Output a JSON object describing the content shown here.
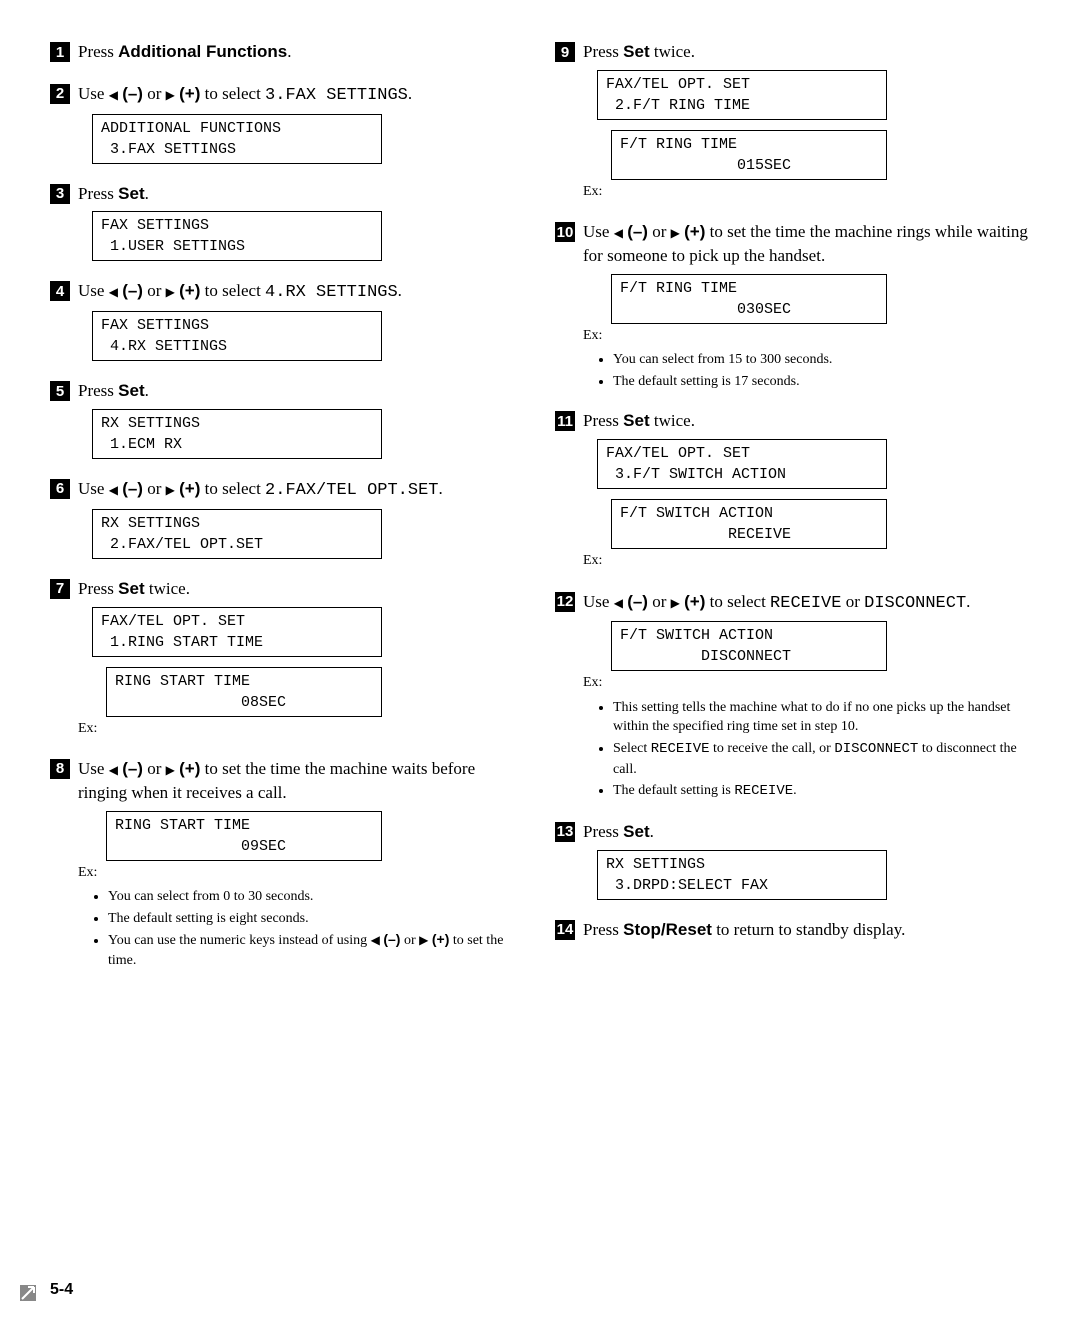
{
  "left": {
    "s1": {
      "text_a": "Press ",
      "bold": "Additional Functions",
      "text_b": "."
    },
    "s2": {
      "text_a": "Use ",
      "minus": "(–)",
      "or": " or ",
      "plus": "(+)",
      "text_b": " to select ",
      "mono": "3.FAX SETTINGS",
      "text_c": ".",
      "disp": "ADDITIONAL FUNCTIONS\n 3.FAX SETTINGS"
    },
    "s3": {
      "text_a": "Press ",
      "bold": "Set",
      "text_b": ".",
      "disp": "FAX SETTINGS\n 1.USER SETTINGS"
    },
    "s4": {
      "text_a": "Use ",
      "minus": "(–)",
      "or": " or ",
      "plus": "(+)",
      "text_b": " to select ",
      "mono": "4.RX SETTINGS",
      "text_c": ".",
      "disp": "FAX SETTINGS\n 4.RX SETTINGS"
    },
    "s5": {
      "text_a": "Press ",
      "bold": "Set",
      "text_b": ".",
      "disp": "RX SETTINGS\n 1.ECM RX"
    },
    "s6": {
      "text_a": "Use ",
      "minus": "(–)",
      "or": " or ",
      "plus": "(+)",
      "text_b": " to select ",
      "mono": "2.FAX/TEL OPT.SET",
      "text_c": ".",
      "disp": "RX SETTINGS\n 2.FAX/TEL OPT.SET"
    },
    "s7": {
      "text_a": "Press ",
      "bold": "Set",
      "text_b": " twice.",
      "disp1": "FAX/TEL OPT. SET\n 1.RING START TIME",
      "disp2": "RING START TIME\n              08SEC",
      "ex": "Ex:"
    },
    "s8": {
      "text_a": "Use ",
      "minus": "(–)",
      "or": " or ",
      "plus": "(+)",
      "text_b": " to set the time the machine waits before ringing when it receives a call.",
      "disp": "RING START TIME\n              09SEC",
      "ex": "Ex:",
      "b1": "You can select from 0 to 30 seconds.",
      "b2": "The default setting is eight seconds.",
      "b3a": "You can use the numeric keys instead of using ",
      "b3_minus": "(–)",
      "b3_or": " or ",
      "b3_plus": "(+)",
      "b3b": " to set the time."
    }
  },
  "right": {
    "s9": {
      "text_a": "Press ",
      "bold": "Set",
      "text_b": " twice.",
      "disp1": "FAX/TEL OPT. SET\n 2.F/T RING TIME",
      "disp2": "F/T RING TIME\n             015SEC",
      "ex": "Ex:"
    },
    "s10": {
      "text_a": "Use ",
      "minus": "(–)",
      "or": " or ",
      "plus": "(+)",
      "text_b": " to set the time the machine rings while waiting for someone to pick up the handset.",
      "disp": "F/T RING TIME\n             030SEC",
      "ex": "Ex:",
      "b1": "You can select from 15 to 300 seconds.",
      "b2": "The default setting is 17 seconds."
    },
    "s11": {
      "text_a": "Press ",
      "bold": "Set",
      "text_b": " twice.",
      "disp1": "FAX/TEL OPT. SET\n 3.F/T SWITCH ACTION",
      "disp2": "F/T SWITCH ACTION\n            RECEIVE",
      "ex": "Ex:"
    },
    "s12": {
      "text_a": "Use ",
      "minus": "(–)",
      "or": " or ",
      "plus": "(+)",
      "text_b": " to select ",
      "mono1": "RECEIVE",
      "or2": " or ",
      "mono2": "DISCONNECT",
      "text_c": ".",
      "disp": "F/T SWITCH ACTION\n         DISCONNECT",
      "ex": "Ex:",
      "b1": "This setting tells the machine what to do if no one picks up the handset within the specified ring time set in step 10.",
      "b2a": "Select ",
      "b2m1": "RECEIVE",
      "b2b": " to receive the call, or ",
      "b2m2": "DISCONNECT",
      "b2c": " to disconnect the call.",
      "b3a": "The default setting is ",
      "b3m": "RECEIVE",
      "b3b": "."
    },
    "s13": {
      "text_a": "Press ",
      "bold": "Set",
      "text_b": ".",
      "disp": "RX SETTINGS\n 3.DRPD:SELECT FAX"
    },
    "s14": {
      "text_a": "Press ",
      "bold": "Stop/Reset",
      "text_b": " to return to standby display."
    }
  },
  "pageNum": "5-4"
}
